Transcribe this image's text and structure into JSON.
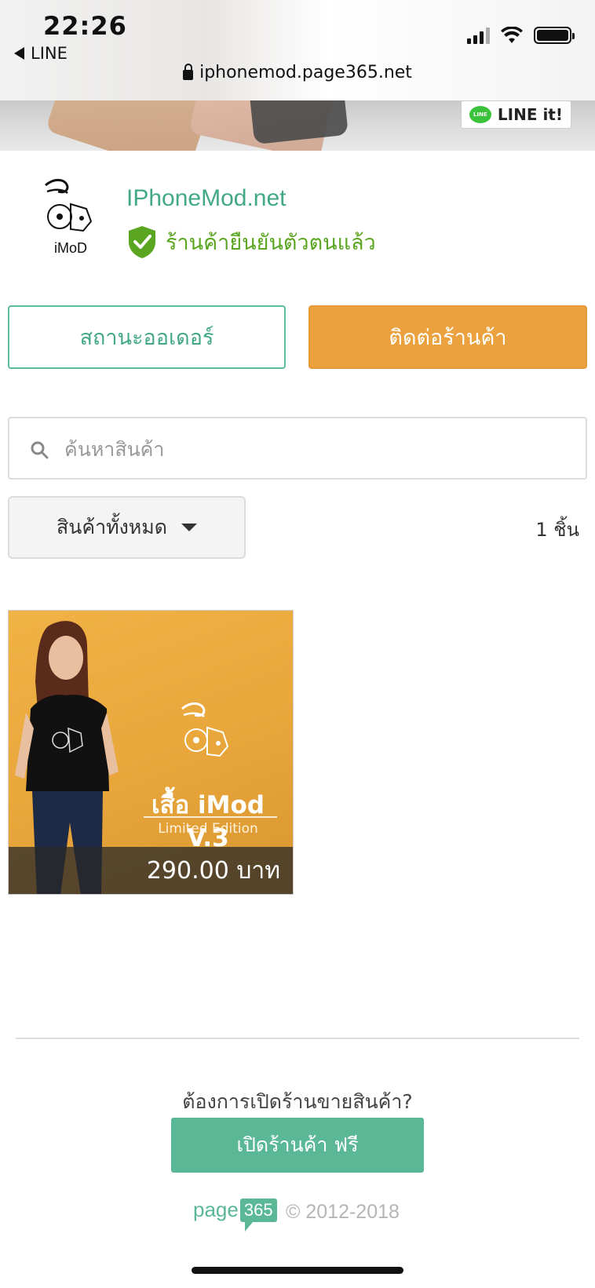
{
  "status_bar": {
    "time": "22:26",
    "back_app": "LINE",
    "icons": [
      "signal-icon",
      "wifi-icon",
      "battery-icon"
    ]
  },
  "browser": {
    "url": "iphonemod.page365.net"
  },
  "hero": {
    "line_button": "LINE it!",
    "line_logo_text": "LINE"
  },
  "shop": {
    "logo_text": "iMoD",
    "name": "IPhoneMod.net",
    "verified_text": "ร้านค้ายืนยันตัวตนแล้ว"
  },
  "actions": {
    "order_status": "สถานะออเดอร์",
    "contact_shop": "ติดต่อร้านค้า"
  },
  "search": {
    "placeholder": "ค้นหาสินค้า"
  },
  "filter": {
    "category": "สินค้าทั้งหมด",
    "count": "1 ชิ้น"
  },
  "products": [
    {
      "name": "เสื้อ iMod V.3",
      "edition": "Limited Edition",
      "price": "290.00 บาท"
    }
  ],
  "footer": {
    "question": "ต้องการเปิดร้านขายสินค้า?",
    "open_shop": "เปิดร้านค้า ฟรี",
    "brand_page": "page",
    "brand_num": "365",
    "copyright": "© 2012-2018"
  },
  "colors": {
    "accent_green": "#5bb897",
    "accent_orange": "#eba13d",
    "verified_green": "#5aa620"
  }
}
